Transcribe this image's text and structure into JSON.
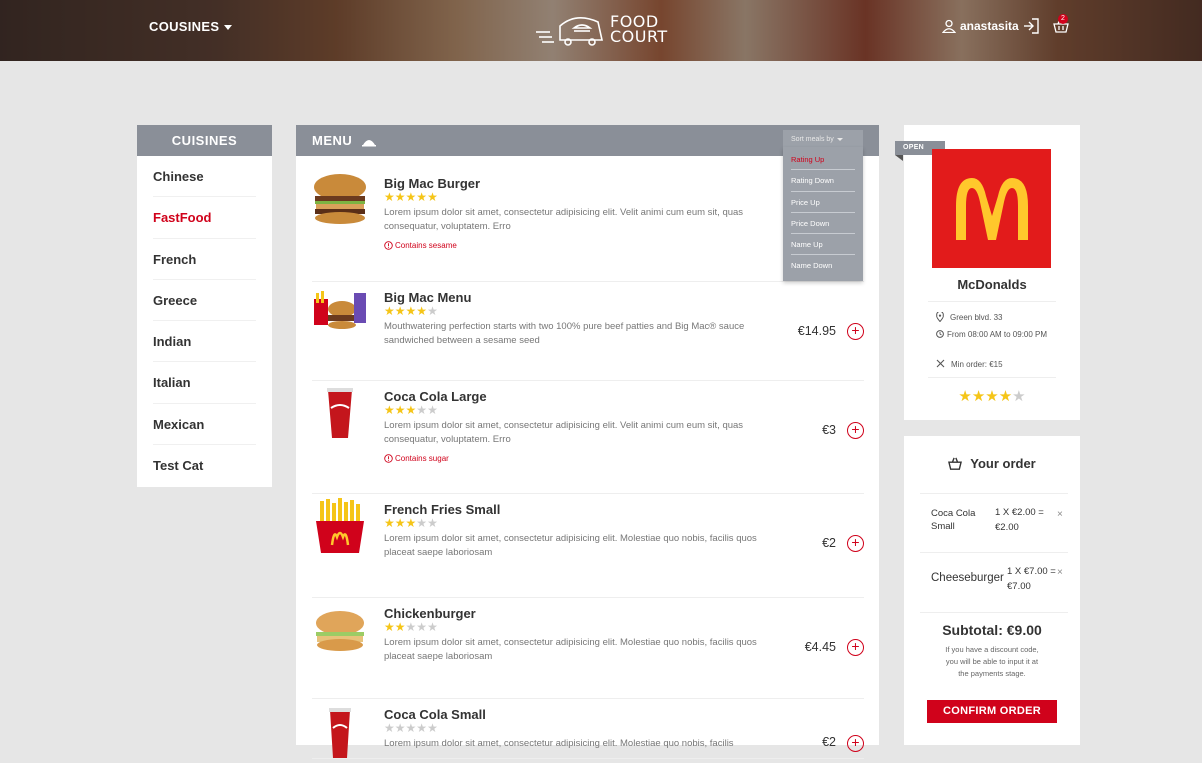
{
  "header": {
    "cuisines_label": "COUSINES",
    "logo_line1": "FOOD",
    "logo_line2": "COURT",
    "username": "anastasita",
    "cart_count": "2"
  },
  "sidebar": {
    "title": "CUISINES",
    "items": [
      {
        "label": "Chinese",
        "active": false
      },
      {
        "label": "FastFood",
        "active": true
      },
      {
        "label": "French",
        "active": false
      },
      {
        "label": "Greece",
        "active": false
      },
      {
        "label": "Indian",
        "active": false
      },
      {
        "label": "Italian",
        "active": false
      },
      {
        "label": "Mexican",
        "active": false
      },
      {
        "label": "Test Cat",
        "active": false
      }
    ]
  },
  "menu": {
    "title": "MENU",
    "sort_label": "Sort meals by",
    "sort_options": [
      "Rating Up",
      "Rating Down",
      "Price Up",
      "Price Down",
      "Name Up",
      "Name Down"
    ],
    "sort_active": "Rating Up",
    "items": [
      {
        "name": "Big Mac Burger",
        "rating": 5,
        "description": "Lorem ipsum dolor sit amet, consectetur adipisicing elit. Velit animi cum eum sit, quas consequatur, voluptatem. Erro",
        "warning": "Contains sesame",
        "price": ""
      },
      {
        "name": "Big Mac Menu",
        "rating": 4,
        "description": "Mouthwatering perfection starts with two 100% pure beef patties and Big Mac® sauce sandwiched between a sesame seed",
        "warning": "",
        "price": "€14.95"
      },
      {
        "name": "Coca Cola Large",
        "rating": 3,
        "description": "Lorem ipsum dolor sit amet, consectetur adipisicing elit. Velit animi cum eum sit, quas consequatur, voluptatem. Erro",
        "warning": "Contains sugar",
        "price": "€3"
      },
      {
        "name": "French Fries Small",
        "rating": 3,
        "description": "Lorem ipsum dolor sit amet, consectetur adipisicing elit. Molestiae quo nobis, facilis quos placeat saepe laboriosam",
        "warning": "",
        "price": "€2"
      },
      {
        "name": "Chickenburger",
        "rating": 2,
        "description": "Lorem ipsum dolor sit amet, consectetur adipisicing elit. Molestiae quo nobis, facilis quos placeat saepe laboriosam",
        "warning": "",
        "price": "€4.45"
      },
      {
        "name": "Coca Cola Small",
        "rating": 0,
        "description": "Lorem ipsum dolor sit amet, consectetur adipisicing elit. Molestiae quo nobis, facilis",
        "warning": "",
        "price": "€2"
      }
    ]
  },
  "restaurant": {
    "status": "OPEN",
    "name": "McDonalds",
    "address": "Green blvd. 33",
    "hours": "From 08:00 AM to 09:00 PM",
    "min_order": "Min order: €15",
    "rating": 4
  },
  "order": {
    "title": "Your order",
    "lines": [
      {
        "name": "Coca Cola Small",
        "qty": "1 X €2.00 = €2.00"
      },
      {
        "name": "Cheeseburger",
        "qty": "1 X €7.00 = €7.00"
      }
    ],
    "subtotal": "Subtotal: €9.00",
    "discount_note": "If you have a discount code, you will be able to input it at the payments stage.",
    "confirm_label": "CONFIRM ORDER"
  },
  "colors": {
    "accent": "#d0021b",
    "panel_header": "#8a8f98",
    "star": "#f5c518",
    "brand_red": "#e21b1b",
    "brand_yellow": "#ffc72c"
  }
}
